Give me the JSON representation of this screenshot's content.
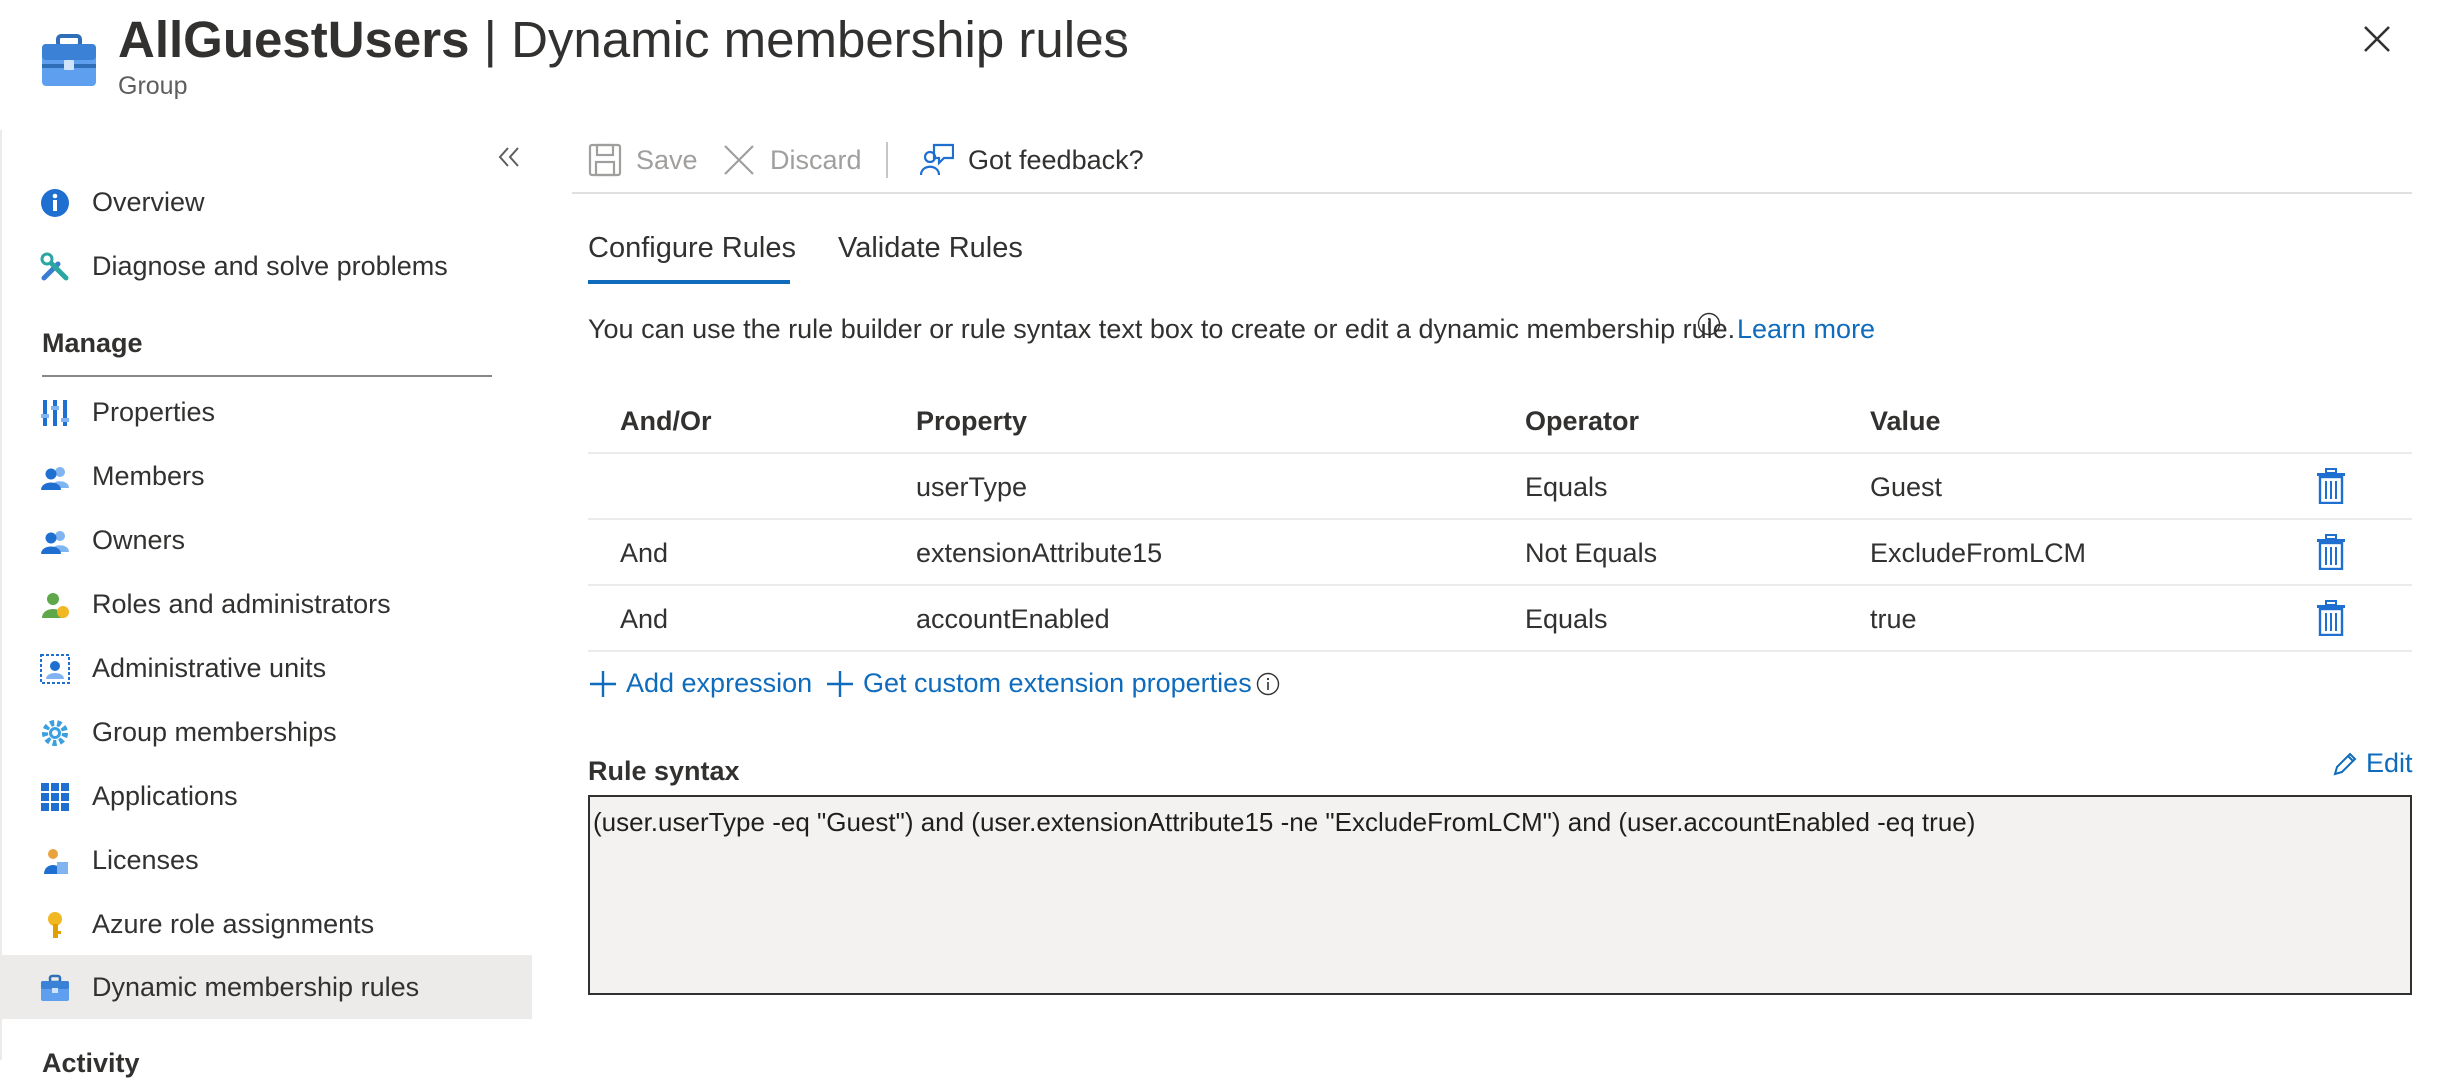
{
  "header": {
    "title_name": "AllGuestUsers",
    "title_separator": "|",
    "title_page": "Dynamic membership rules",
    "subtitle": "Group",
    "more_label": "···"
  },
  "sidebar": {
    "items_top": [
      {
        "label": "Overview",
        "icon": "info-icon"
      },
      {
        "label": "Diagnose and solve problems",
        "icon": "wrench-icon"
      }
    ],
    "section_manage": "Manage",
    "items_manage": [
      {
        "label": "Properties",
        "icon": "properties-icon"
      },
      {
        "label": "Members",
        "icon": "members-icon"
      },
      {
        "label": "Owners",
        "icon": "owners-icon"
      },
      {
        "label": "Roles and administrators",
        "icon": "roles-icon"
      },
      {
        "label": "Administrative units",
        "icon": "admin-units-icon"
      },
      {
        "label": "Group memberships",
        "icon": "gear-icon"
      },
      {
        "label": "Applications",
        "icon": "grid-icon"
      },
      {
        "label": "Licenses",
        "icon": "license-icon"
      },
      {
        "label": "Azure role assignments",
        "icon": "key-icon"
      },
      {
        "label": "Dynamic membership rules",
        "icon": "briefcase-icon",
        "active": true
      }
    ],
    "section_activity_partial": "Activity"
  },
  "toolbar": {
    "save_label": "Save",
    "discard_label": "Discard",
    "feedback_label": "Got feedback?"
  },
  "tabs": {
    "configure": "Configure Rules",
    "validate": "Validate Rules",
    "active": "configure"
  },
  "info": {
    "text": "You can use the rule builder or rule syntax text box to create or edit a dynamic membership rule.",
    "learn_more": "Learn more"
  },
  "table": {
    "headers": [
      "And/Or",
      "Property",
      "Operator",
      "Value"
    ],
    "rows": [
      {
        "andor": "",
        "property": "userType",
        "operator": "Equals",
        "value": "Guest"
      },
      {
        "andor": "And",
        "property": "extensionAttribute15",
        "operator": "Not Equals",
        "value": "ExcludeFromLCM"
      },
      {
        "andor": "And",
        "property": "accountEnabled",
        "operator": "Equals",
        "value": "true"
      }
    ]
  },
  "actions": {
    "add_expression": "Add expression",
    "get_custom": "Get custom extension properties"
  },
  "rule_syntax": {
    "label": "Rule syntax",
    "edit_label": "Edit",
    "value": "(user.userType -eq \"Guest\") and (user.extensionAttribute15 -ne \"ExcludeFromLCM\") and (user.accountEnabled -eq true)"
  },
  "colors": {
    "accent": "#0f6cbd",
    "active_bg": "#edebe9",
    "syntax_bg": "#f3f2f1"
  }
}
